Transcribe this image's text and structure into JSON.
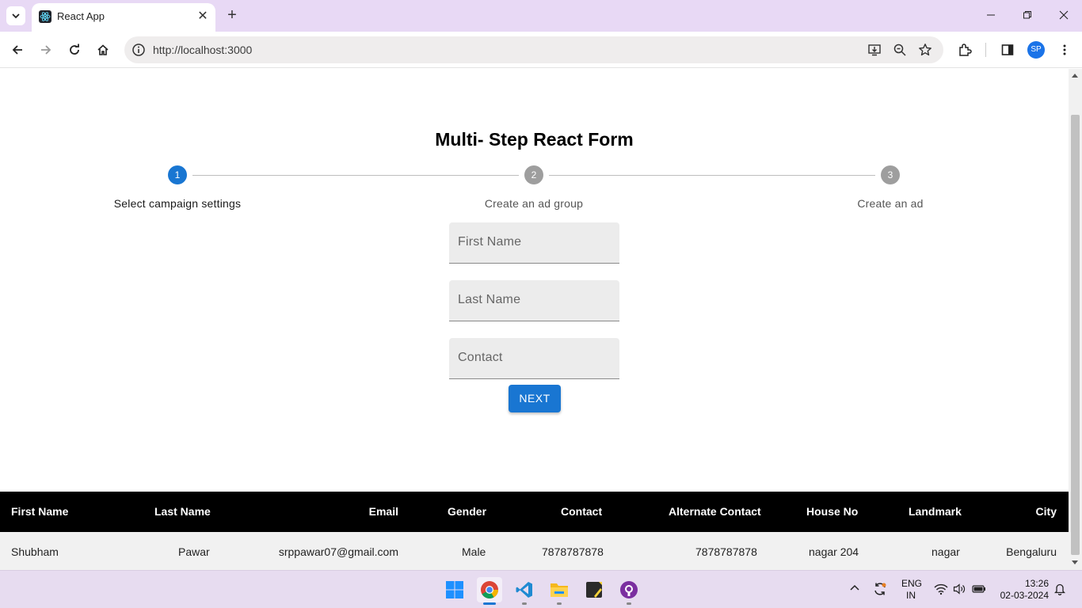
{
  "browser": {
    "tab_title": "React App",
    "url": "http://localhost:3000",
    "profile_initials": "SP"
  },
  "form": {
    "title": "Multi- Step React Form",
    "steps": [
      {
        "number": "1",
        "label": "Select campaign settings",
        "active": true
      },
      {
        "number": "2",
        "label": "Create an ad group",
        "active": false
      },
      {
        "number": "3",
        "label": "Create an ad",
        "active": false
      }
    ],
    "fields": [
      {
        "placeholder": "First Name",
        "value": ""
      },
      {
        "placeholder": "Last Name",
        "value": ""
      },
      {
        "placeholder": "Contact",
        "value": ""
      }
    ],
    "next_label": "NEXT"
  },
  "table": {
    "headers": [
      "First Name",
      "Last Name",
      "Email",
      "Gender",
      "Contact",
      "Alternate Contact",
      "House No",
      "Landmark",
      "City"
    ],
    "rows": [
      [
        "Shubham",
        "Pawar",
        "srppawar07@gmail.com",
        "Male",
        "7878787878",
        "7878787878",
        "nagar 204",
        "nagar",
        "Bengaluru"
      ]
    ]
  },
  "taskbar": {
    "language": "ENG",
    "region": "IN",
    "time": "13:26",
    "date": "02-03-2024"
  },
  "colors": {
    "accent": "#1976d2",
    "step_inactive": "#9e9e9e",
    "chrome_frame": "#e8d9f5",
    "table_header": "#000000"
  },
  "icons": [
    "tab-list-icon",
    "react-favicon-icon",
    "close-icon",
    "plus-icon",
    "minimize-icon",
    "restore-icon",
    "back-icon",
    "forward-icon",
    "reload-icon",
    "home-icon",
    "info-icon",
    "install-icon",
    "zoom-icon",
    "star-icon",
    "extensions-icon",
    "side-panel-icon",
    "more-icon",
    "windows-start-icon",
    "chrome-icon",
    "vscode-icon",
    "file-explorer-icon",
    "sticky-notes-icon",
    "github-icon",
    "chevron-up-icon",
    "sync-icon",
    "wifi-icon",
    "volume-icon",
    "battery-icon",
    "bell-icon"
  ]
}
